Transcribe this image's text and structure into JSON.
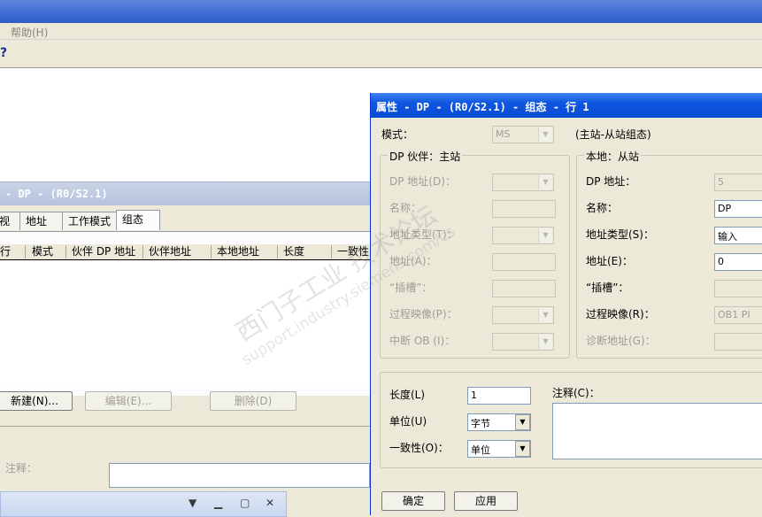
{
  "menu": {
    "help": "帮助(H)"
  },
  "toolbar": {
    "help_icon": "help-question-icon",
    "help_glyph": "?"
  },
  "bg_window": {
    "title": "- DP - (R0/S2.1)",
    "tabs": [
      "视",
      "地址",
      "工作模式",
      "组态"
    ],
    "columns": [
      "行",
      "模式",
      "伙伴 DP 地址",
      "伙伴地址",
      "本地地址",
      "长度",
      "一致性"
    ],
    "buttons": {
      "new": "新建(N)...",
      "edit": "编辑(E)...",
      "delete": "删除(D)"
    },
    "comment_label": "注释："
  },
  "dialog": {
    "title": "属性 - DP - (R0/S2.1) - 组态 - 行 1",
    "mode_label": "模式：",
    "mode_value": "MS",
    "mode_desc": "(主站-从站组态)",
    "partner": {
      "title": "DP 伙伴：主站",
      "dp_address": "DP 地址(D)：",
      "name": "名称：",
      "address_type": "地址类型(T)：",
      "address": "地址(A)：",
      "slot": "“插槽”：",
      "process_image": "过程映像(P)：",
      "interrupt_ob": "中断 OB (I)："
    },
    "local": {
      "title": "本地：从站",
      "dp_address": "DP 地址：",
      "dp_address_value": "5",
      "name": "名称：",
      "name_value": "DP",
      "address_type": "地址类型(S)：",
      "address_type_value": "输入",
      "address": "地址(E)：",
      "address_value": "0",
      "slot": "“插槽”：",
      "process_image": "过程映像(R)：",
      "process_image_value": "OB1 PI",
      "diag_address": "诊断地址(G)："
    },
    "length_label": "长度(L)",
    "length_value": "1",
    "unit_label": "单位(U)",
    "unit_value": "字节",
    "consistency_label": "一致性(O)：",
    "consistency_value": "单位",
    "comment_label": "注释(C)：",
    "ok": "确定",
    "apply": "应用"
  },
  "watermark": {
    "main": "西门子工业 技术论坛",
    "url": "support.industry.siemens.com/cs"
  }
}
